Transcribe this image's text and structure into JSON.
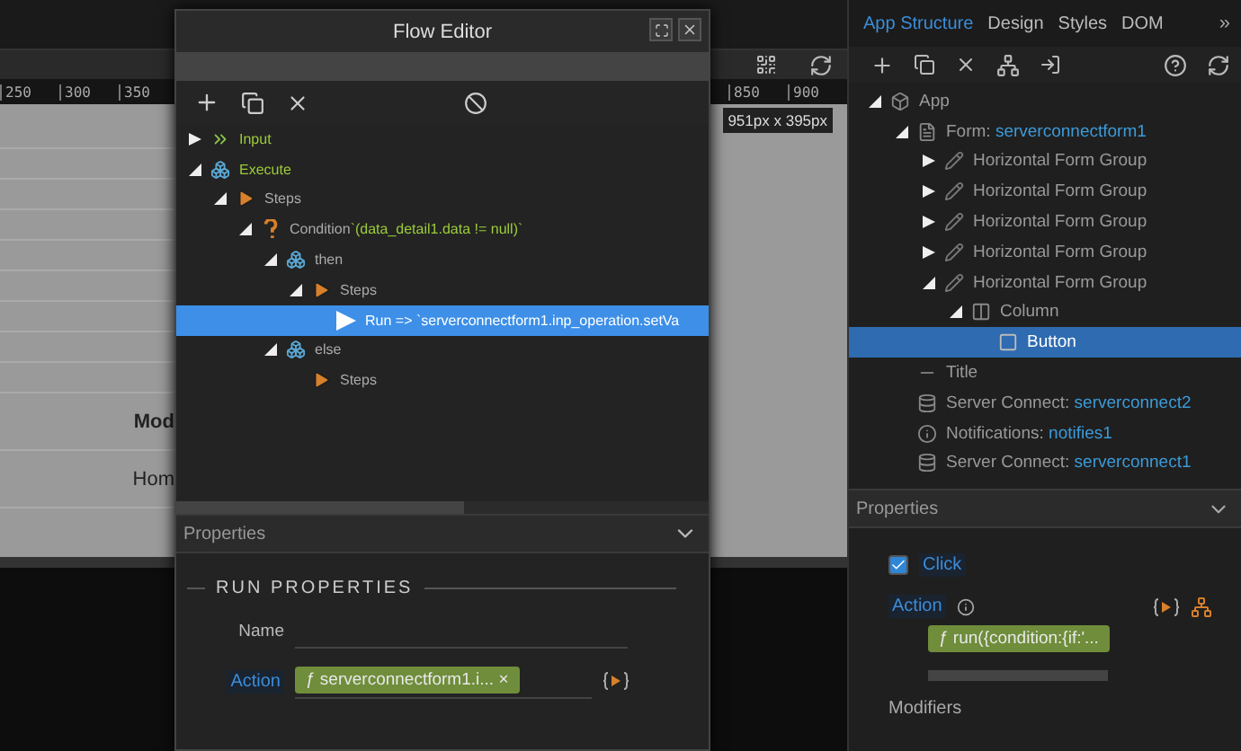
{
  "ruler": {
    "left_ticks": [
      "250",
      "300",
      "350"
    ],
    "right_ticks": [
      "850",
      "900"
    ],
    "size_badge": "951px x 395px"
  },
  "canvas": {
    "texts": [
      {
        "text": "Mod",
        "kind": "heading"
      },
      {
        "text": "Hom",
        "kind": "link"
      }
    ]
  },
  "flow_editor": {
    "title": "Flow Editor",
    "tree": [
      {
        "label": "Input",
        "kind": "input",
        "expanded": false,
        "selected": false,
        "highlight": true
      },
      {
        "label": "Execute",
        "kind": "block",
        "expanded": true,
        "selected": false,
        "highlight": true,
        "children": [
          {
            "label": "Steps",
            "kind": "steps",
            "expanded": true,
            "selected": false,
            "children": [
              {
                "label": "Condition",
                "value": "`(data_detail1.data != null)`",
                "kind": "condition",
                "expanded": true,
                "selected": false,
                "children": [
                  {
                    "label": "then",
                    "kind": "block",
                    "expanded": true,
                    "selected": false,
                    "children": [
                      {
                        "label": "Steps",
                        "kind": "steps",
                        "expanded": true,
                        "selected": false,
                        "children": [
                          {
                            "label": "Run => `serverconnectform1.inp_operation.setVa",
                            "kind": "run",
                            "selected": true
                          }
                        ]
                      }
                    ]
                  },
                  {
                    "label": "else",
                    "kind": "block",
                    "expanded": true,
                    "selected": false,
                    "children": [
                      {
                        "label": "Steps",
                        "kind": "steps",
                        "selected": false
                      }
                    ]
                  }
                ]
              }
            ]
          }
        ]
      }
    ],
    "properties": {
      "header": "Properties",
      "section": "RUN PROPERTIES",
      "name_label": "Name",
      "action_label": "Action",
      "action_value": "ƒ serverconnectform1.i...",
      "remove": "×"
    }
  },
  "app_panel": {
    "tabs": [
      {
        "label": "App Structure",
        "selected": true
      },
      {
        "label": "Design",
        "selected": false
      },
      {
        "label": "Styles",
        "selected": false
      },
      {
        "label": "DOM",
        "selected": false
      }
    ],
    "more": "»",
    "tree": [
      {
        "label": "App",
        "kind": "app",
        "expanded": true,
        "selected": false,
        "children": [
          {
            "label": "Form: ",
            "value": "serverconnectform1",
            "kind": "form",
            "expanded": true,
            "selected": false,
            "children": [
              {
                "label": "Horizontal Form Group",
                "kind": "group",
                "expanded": false,
                "selected": false
              },
              {
                "label": "Horizontal Form Group",
                "kind": "group",
                "expanded": false,
                "selected": false
              },
              {
                "label": "Horizontal Form Group",
                "kind": "group",
                "expanded": false,
                "selected": false
              },
              {
                "label": "Horizontal Form Group",
                "kind": "group",
                "expanded": false,
                "selected": false
              },
              {
                "label": "Horizontal Form Group",
                "kind": "group",
                "expanded": true,
                "selected": false,
                "children": [
                  {
                    "label": "Column",
                    "kind": "column",
                    "expanded": true,
                    "selected": false,
                    "children": [
                      {
                        "label": "Button",
                        "kind": "button",
                        "selected": true
                      }
                    ]
                  }
                ]
              }
            ]
          },
          {
            "label": "Title",
            "kind": "title",
            "selected": false
          },
          {
            "label": "Server Connect: ",
            "value": "serverconnect2",
            "kind": "server",
            "selected": false
          },
          {
            "label": "Notifications: ",
            "value": "notifies1",
            "kind": "notify",
            "selected": false
          },
          {
            "label": "Server Connect: ",
            "value": "serverconnect1",
            "kind": "server",
            "selected": false
          }
        ]
      }
    ],
    "properties": {
      "header": "Properties",
      "event": {
        "label": "Click",
        "checked": true
      },
      "action_label": "Action",
      "action_value": "ƒ run({condition:{if:'...",
      "modifiers_label": "Modifiers"
    }
  }
}
